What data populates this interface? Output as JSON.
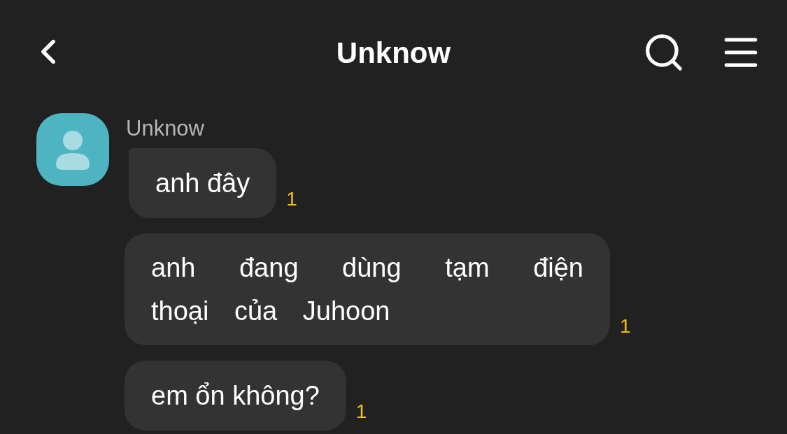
{
  "header": {
    "title": "Unknow"
  },
  "chat": {
    "sender": "Unknow",
    "messages": [
      {
        "text": "anh đây",
        "unread": "1",
        "tail": true
      },
      {
        "text": "anh đang dùng tạm điện thoại của Juhoon",
        "unread": "1",
        "tail": false
      },
      {
        "text": "em ổn không?",
        "unread": "1",
        "tail": false
      }
    ]
  }
}
